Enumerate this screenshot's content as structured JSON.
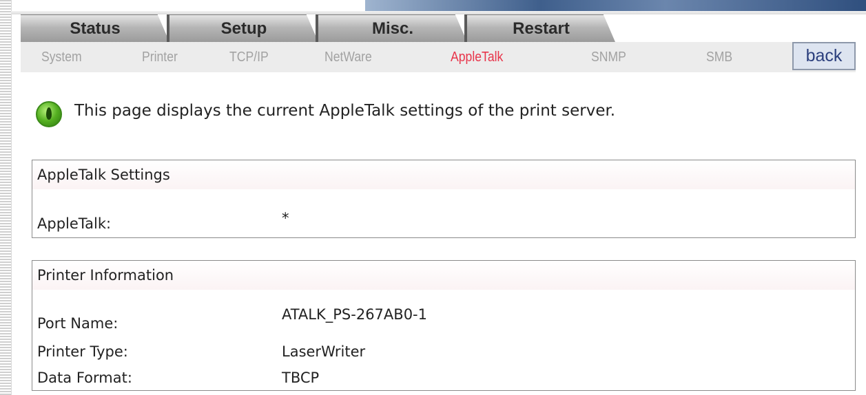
{
  "tabs": [
    {
      "label": "Status"
    },
    {
      "label": "Setup"
    },
    {
      "label": "Misc."
    },
    {
      "label": "Restart"
    }
  ],
  "subnav": {
    "items": [
      {
        "label": "System"
      },
      {
        "label": "Printer"
      },
      {
        "label": "TCP/IP"
      },
      {
        "label": "NetWare"
      },
      {
        "label": "AppleTalk",
        "active": true
      },
      {
        "label": "SNMP"
      },
      {
        "label": "SMB"
      }
    ],
    "back_label": "back"
  },
  "info": {
    "text": "This page displays the current AppleTalk settings of the print server."
  },
  "appletalk_settings": {
    "title": "AppleTalk Settings",
    "rows": [
      {
        "label": "AppleTalk:",
        "value": "*"
      }
    ]
  },
  "printer_information": {
    "title": "Printer Information",
    "rows": [
      {
        "label": "Port Name:",
        "value": "ATALK_PS-267AB0-1"
      },
      {
        "label": "Printer Type:",
        "value": "LaserWriter"
      },
      {
        "label": "Data Format:",
        "value": "TBCP"
      }
    ]
  },
  "colors": {
    "active_subnav": "#e8344a",
    "inactive_subnav": "#a2a2a2",
    "back_button_text": "#2b3f7d"
  },
  "icons": {
    "info": "green-info-icon"
  }
}
